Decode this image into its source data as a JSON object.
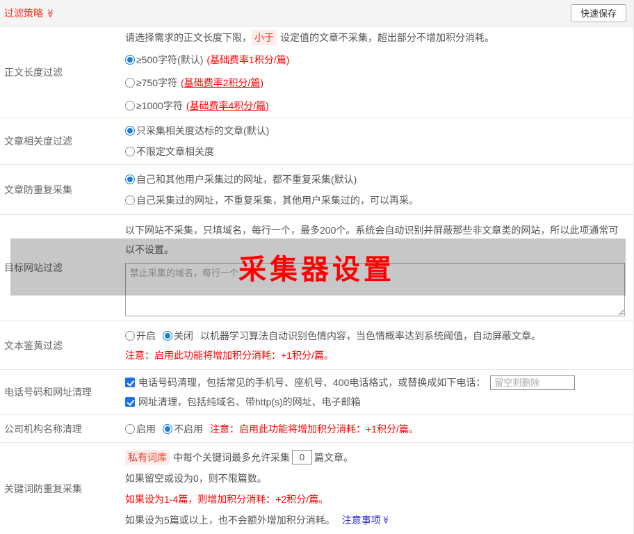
{
  "header": {
    "title": "过滤策略",
    "save_button": "快速保存"
  },
  "icons": {
    "double_chevron_down": "≫"
  },
  "watermark": "采集器设置",
  "rows": {
    "length": {
      "label": "正文长度过滤",
      "intro_before": "请选择需求的正文长度下限，",
      "intro_highlight": "小于",
      "intro_after": "设定值的文章不采集，超出部分不增加积分消耗。",
      "options": [
        {
          "text": "≥500字符(默认)",
          "note": "(基础费率1积分/篇)",
          "checked": true
        },
        {
          "text": "≥750字符",
          "note": "(基础费率2积分/篇)",
          "checked": false
        },
        {
          "text": "≥1000字符",
          "note": "(基础费率4积分/篇)",
          "checked": false
        }
      ]
    },
    "relevance": {
      "label": "文章相关度过滤",
      "options": [
        {
          "text": "只采集相关度达标的文章(默认)",
          "checked": true
        },
        {
          "text": "不限定文章相关度",
          "checked": false
        }
      ]
    },
    "dedupe": {
      "label": "文章防重复采集",
      "options": [
        {
          "text": "自己和其他用户采集过的网址，都不重复采集(默认)",
          "checked": true
        },
        {
          "text": "自己采集过的网址，不重复采集，其他用户采集过的，可以再采。",
          "checked": false
        }
      ]
    },
    "site_filter": {
      "label": "目标网站过滤",
      "description": "以下网站不采集，只填域名，每行一个，最多200个。系统会自动识别并屏蔽那些非文章类的网站，所以此项通常可以不设置。",
      "textarea_placeholder": "禁止采集的域名，每行一个"
    },
    "porn_filter": {
      "label": "文本鉴黄过滤",
      "option_on": "开启",
      "option_off": "关闭",
      "description": "以机器学习算法自动识别色情内容，当色情概率达到系统阈值，自动屏蔽文章。",
      "warning": "注意：启用此功能将增加积分消耗：+1积分/篇。"
    },
    "phone_url": {
      "label": "电话号码和网址清理",
      "checkbox_phone": "电话号码清理，包括常见的手机号、座机号、400电话格式，或替换成如下电话：",
      "phone_placeholder": "留空则删除",
      "checkbox_url": "网址清理，包括纯域名、带http(s)的网址、电子邮箱"
    },
    "company": {
      "label": "公司机构名称清理",
      "option_on": "启用",
      "option_off": "不启用",
      "warning": "注意：启用此功能将增加积分消耗：+1积分/篇。"
    },
    "keyword": {
      "label": "关键词防重复采集",
      "tag": "私有词库",
      "line1_mid": "中每个关键词最多允许采集",
      "count_value": "0",
      "line1_end": "篇文章。",
      "line2": "如果留空或设为0，则不限篇数。",
      "line3": "如果设为1-4篇，则增加积分消耗：+2积分/篇。",
      "line4": "如果设为5篇或以上，也不会额外增加积分消耗。",
      "link": "注意事项"
    }
  }
}
